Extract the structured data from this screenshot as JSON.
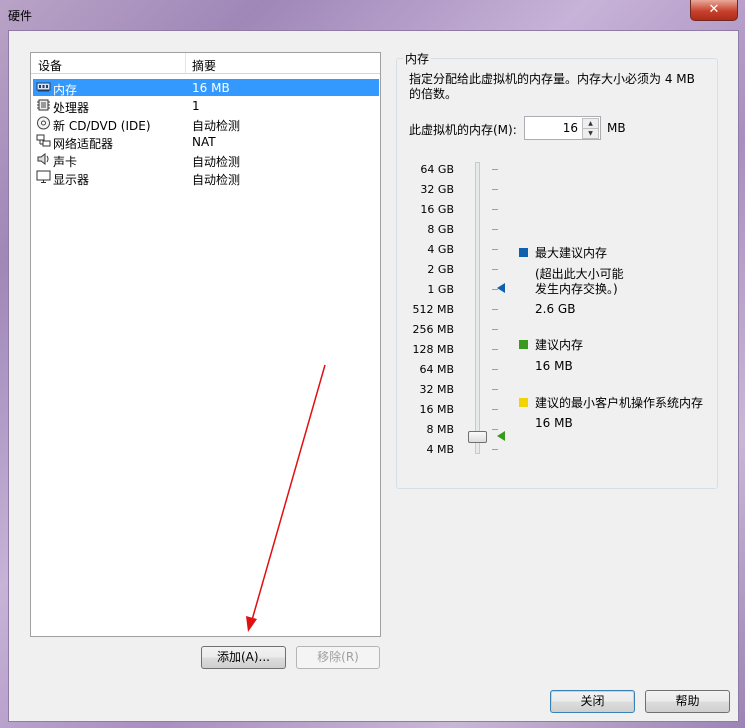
{
  "window": {
    "title": "硬件",
    "close_label": "✕"
  },
  "device_list": {
    "columns": [
      "设备",
      "摘要"
    ],
    "rows": [
      {
        "icon": "memory-icon",
        "name": "内存",
        "summary": "16 MB",
        "selected": true
      },
      {
        "icon": "processor-icon",
        "name": "处理器",
        "summary": "1",
        "selected": false
      },
      {
        "icon": "cd-dvd-icon",
        "name": "新 CD/DVD (IDE)",
        "summary": "自动检测",
        "selected": false
      },
      {
        "icon": "network-adapter-icon",
        "name": "网络适配器",
        "summary": "NAT",
        "selected": false
      },
      {
        "icon": "sound-card-icon",
        "name": "声卡",
        "summary": "自动检测",
        "selected": false
      },
      {
        "icon": "display-icon",
        "name": "显示器",
        "summary": "自动检测",
        "selected": false
      }
    ]
  },
  "list_buttons": {
    "add": "添加(A)...",
    "remove": "移除(R)"
  },
  "memory": {
    "group_title": "内存",
    "description": "指定分配给此虚拟机的内存量。内存大小必须为 4 MB 的倍数。",
    "field_label": "此虚拟机的内存(M):",
    "value": "16",
    "unit": "MB",
    "scale_labels": [
      "64 GB",
      "32 GB",
      "16 GB",
      "8 GB",
      "4 GB",
      "2 GB",
      "1 GB",
      "512 MB",
      "256 MB",
      "128 MB",
      "64 MB",
      "32 MB",
      "16 MB",
      "8 MB",
      "4 MB"
    ],
    "legend": {
      "max": {
        "label": "最大建议内存",
        "note_line1": "(超出此大小可能",
        "note_line2": "发生内存交换。)",
        "value": "2.6 GB",
        "color": "#1060b0"
      },
      "recommended": {
        "label": "建议内存",
        "value": "16 MB",
        "color": "#3a9a1f"
      },
      "min_guest": {
        "label": "建议的最小客户机操作系统内存",
        "value": "16 MB",
        "color": "#f2d400"
      }
    }
  },
  "footer_buttons": {
    "close": "关闭",
    "help": "帮助"
  }
}
